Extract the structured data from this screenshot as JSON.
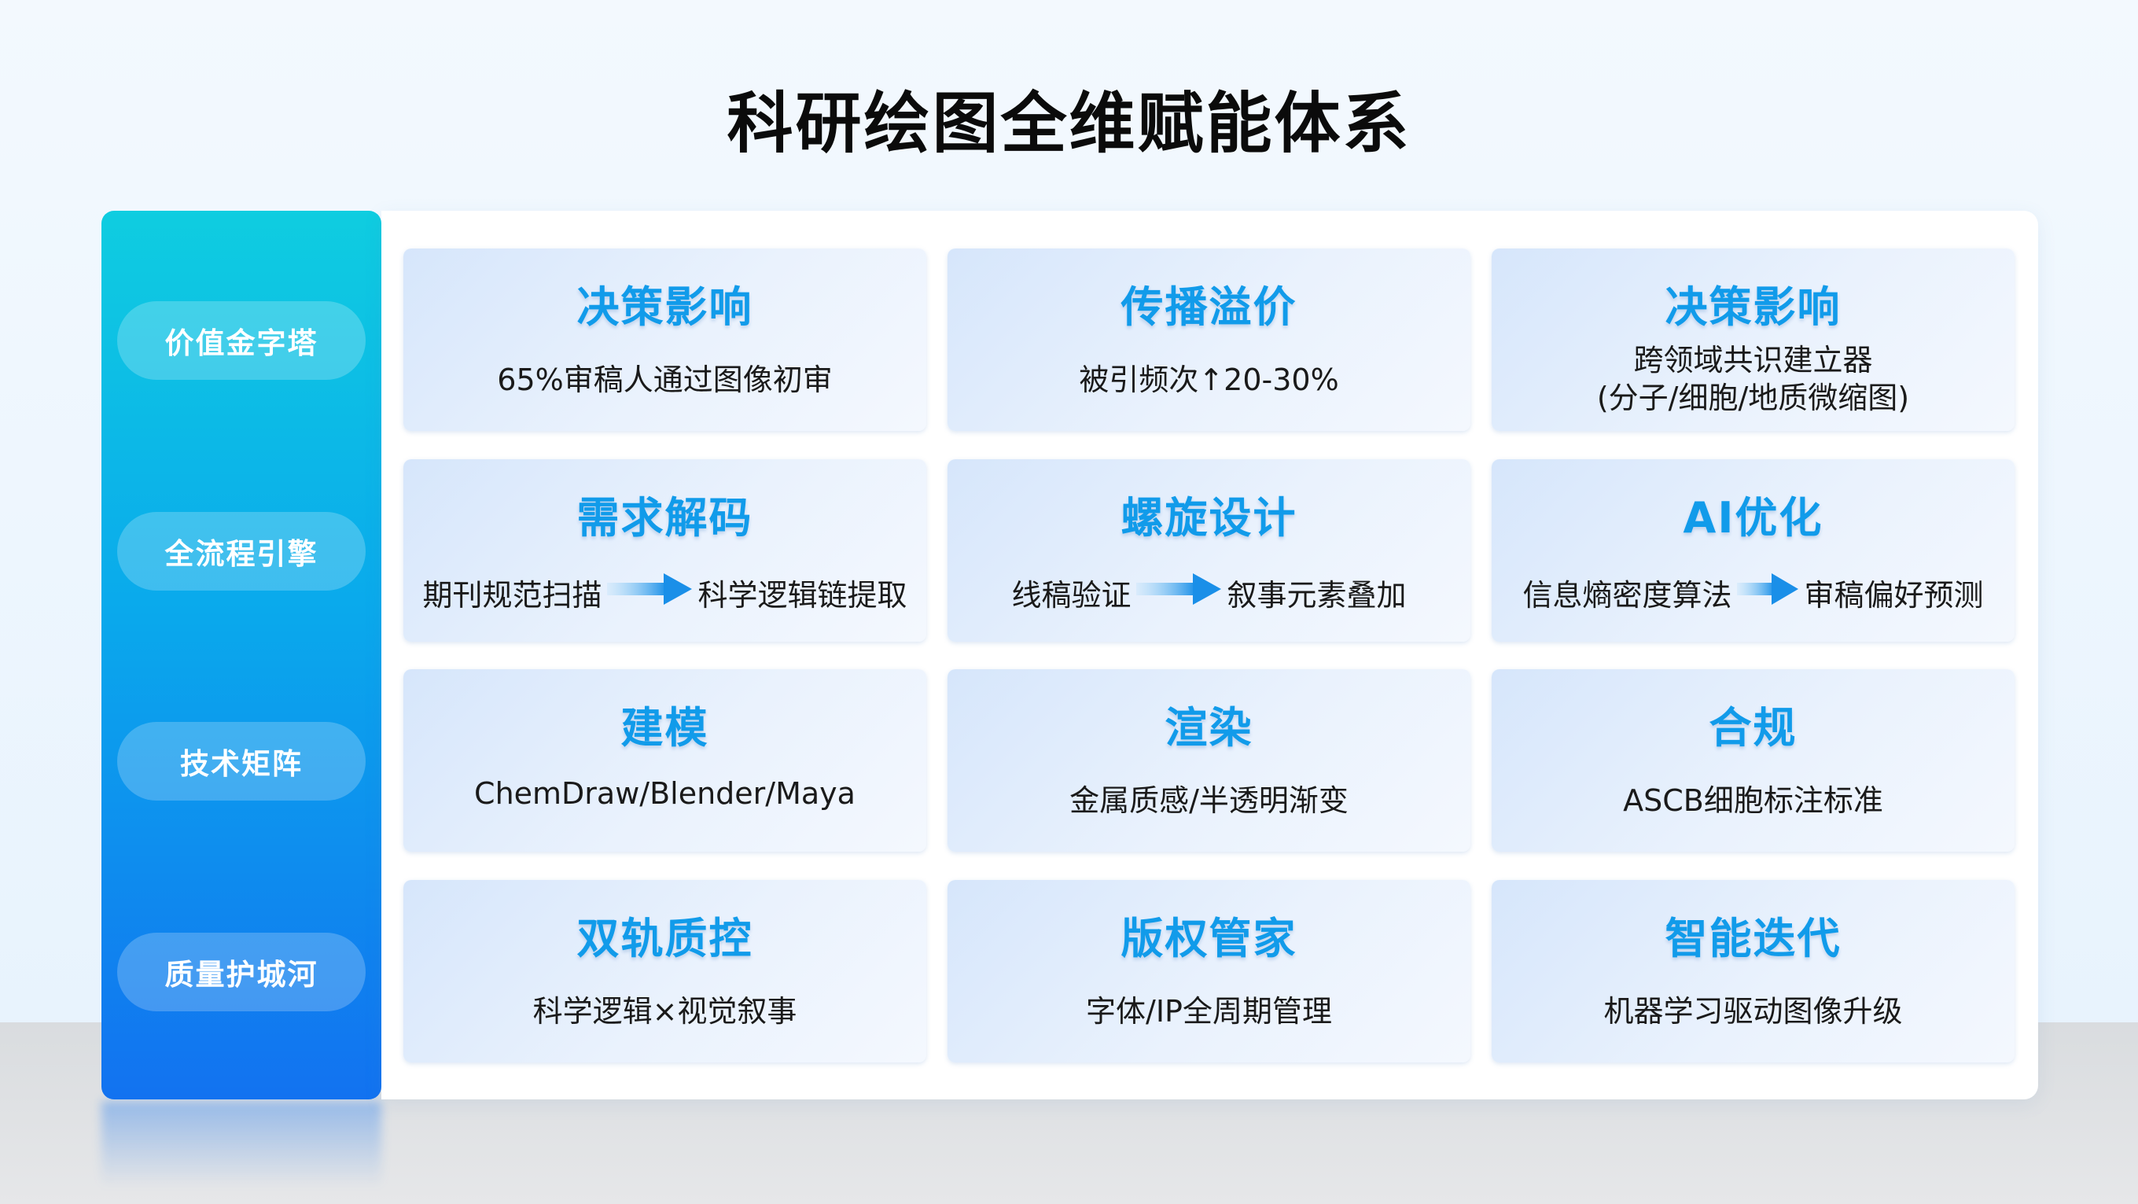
{
  "title": "科研绘图全维赋能体系",
  "sidebar": {
    "items": [
      "价值金字塔",
      "全流程引擎",
      "技术矩阵",
      "质量护城河"
    ]
  },
  "rows": [
    {
      "cards": [
        {
          "title": "决策影响",
          "sub": "65%审稿人通过图像初审"
        },
        {
          "title": "传播溢价",
          "sub": "被引频次↑20-30%"
        },
        {
          "title": "决策影响",
          "sub_line1": "跨领域共识建立器",
          "sub_line2": "(分子/细胞/地质微缩图)"
        }
      ]
    },
    {
      "cards": [
        {
          "title": "需求解码",
          "from": "期刊规范扫描",
          "to": "科学逻辑链提取"
        },
        {
          "title": "螺旋设计",
          "from": "线稿验证",
          "to": "叙事元素叠加"
        },
        {
          "title": "AI优化",
          "from": "信息熵密度算法",
          "to": "审稿偏好预测"
        }
      ]
    },
    {
      "cards": [
        {
          "title": "建模",
          "sub": "ChemDraw/Blender/Maya"
        },
        {
          "title": "渲染",
          "sub": "金属质感/半透明渐变"
        },
        {
          "title": "合规",
          "sub": "ASCB细胞标注标准"
        }
      ]
    },
    {
      "cards": [
        {
          "title": "双轨质控",
          "sub": "科学逻辑×视觉叙事"
        },
        {
          "title": "版权管家",
          "sub": "字体/IP全周期管理"
        },
        {
          "title": "智能迭代",
          "sub": "机器学习驱动图像升级"
        }
      ]
    }
  ],
  "colors": {
    "card_title": "#119bea",
    "sidebar_top": "#0fcde0",
    "sidebar_bottom": "#1272f0",
    "arrow": "#1a8fe8"
  }
}
